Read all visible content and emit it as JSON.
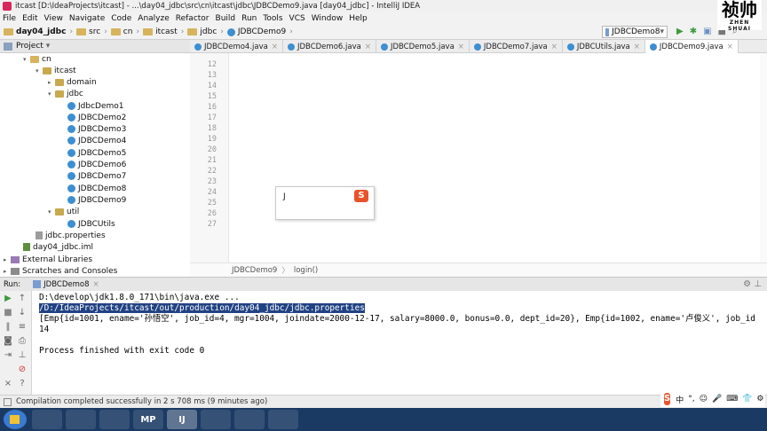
{
  "window": {
    "title": "itcast [D:\\IdeaProjects\\itcast] - ...\\day04_jdbc\\src\\cn\\itcast\\jdbc\\JDBCDemo9.java [day04_jdbc] - IntelliJ IDEA"
  },
  "watermark": {
    "big": "祯帅",
    "small": "ZHEN SHUAI"
  },
  "menu": [
    "File",
    "Edit",
    "View",
    "Navigate",
    "Code",
    "Analyze",
    "Refactor",
    "Build",
    "Run",
    "Tools",
    "VCS",
    "Window",
    "Help"
  ],
  "breadcrumbs": [
    "day04_jdbc",
    "src",
    "cn",
    "itcast",
    "jdbc",
    "JDBCDemo9"
  ],
  "run_config": "JDBCDemo8",
  "project_panel": {
    "title": "Project"
  },
  "tree": [
    {
      "label": "cn",
      "level": 1,
      "kind": "folder",
      "open": true
    },
    {
      "label": "itcast",
      "level": 2,
      "kind": "pkg",
      "open": true
    },
    {
      "label": "domain",
      "level": 3,
      "kind": "pkg",
      "open": false
    },
    {
      "label": "jdbc",
      "level": 3,
      "kind": "pkg",
      "open": true
    },
    {
      "label": "JdbcDemo1",
      "level": 4,
      "kind": "class"
    },
    {
      "label": "JDBCDemo2",
      "level": 4,
      "kind": "class"
    },
    {
      "label": "JDBCDemo3",
      "level": 4,
      "kind": "class"
    },
    {
      "label": "JDBCDemo4",
      "level": 4,
      "kind": "class"
    },
    {
      "label": "JDBCDemo5",
      "level": 4,
      "kind": "class"
    },
    {
      "label": "JDBCDemo6",
      "level": 4,
      "kind": "class"
    },
    {
      "label": "JDBCDemo7",
      "level": 4,
      "kind": "class"
    },
    {
      "label": "JDBCDemo8",
      "level": 4,
      "kind": "class"
    },
    {
      "label": "JDBCDemo9",
      "level": 4,
      "kind": "class"
    },
    {
      "label": "util",
      "level": 3,
      "kind": "pkg",
      "open": true
    },
    {
      "label": "JDBCUtils",
      "level": 4,
      "kind": "class"
    },
    {
      "label": "jdbc.properties",
      "level": 2,
      "kind": "prop"
    },
    {
      "label": "day04_jdbc.iml",
      "level": 1,
      "kind": "iml"
    },
    {
      "label": "External Libraries",
      "level": 0,
      "kind": "lib"
    },
    {
      "label": "Scratches and Consoles",
      "level": 0,
      "kind": "scratch"
    }
  ],
  "tabs": [
    {
      "label": "JDBCDemo4.java",
      "active": false
    },
    {
      "label": "JDBCDemo6.java",
      "active": false
    },
    {
      "label": "JDBCDemo5.java",
      "active": false
    },
    {
      "label": "JDBCDemo7.java",
      "active": false
    },
    {
      "label": "JDBCUtils.java",
      "active": false
    },
    {
      "label": "JDBCDemo9.java",
      "active": true
    }
  ],
  "code": {
    "line_numbers": [
      "12",
      "13",
      "14",
      "15",
      "16",
      "17",
      "18",
      "19",
      "20",
      "21",
      "22",
      "23",
      "24",
      "25",
      "26",
      "27"
    ],
    "editor_breadcrumb": [
      "JDBCDemo9",
      "login()"
    ]
  },
  "completion_popup": {
    "text": "J",
    "ime_logo": "S"
  },
  "run_panel": {
    "label": "Run:",
    "tab": "JDBCDemo8"
  },
  "console": [
    "D:\\develop\\jdk1.8.0_171\\bin\\java.exe ...",
    "/D:/IdeaProjects/itcast/out/production/day04_jdbc/jdbc.properties",
    "[Emp{id=1001, ename='孙悟空', job_id=4, mgr=1004, joindate=2000-12-17, salary=8000.0, bonus=0.0, dept_id=20}, Emp{id=1002, ename='卢俊义', job_id",
    "14",
    "",
    "Process finished with exit code 0"
  ],
  "status": {
    "message": "Compilation completed successfully in 2 s 708 ms (9 minutes ago)"
  },
  "ime_bar": {
    "logo": "S",
    "items": [
      "中",
      "°,",
      "☺",
      "🎤",
      "⌨",
      "👕",
      "⚙"
    ]
  },
  "taskbar": {
    "items": [
      "",
      "",
      "",
      "MP",
      "IJ",
      "",
      "",
      ""
    ]
  }
}
